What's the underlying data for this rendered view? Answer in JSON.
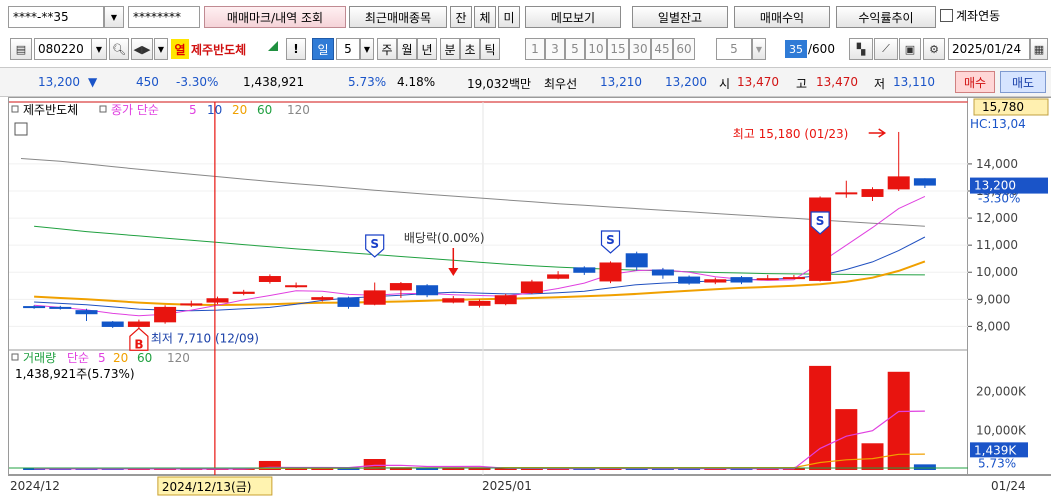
{
  "toolbar1": {
    "account": "****-**35",
    "password": "********",
    "buttons": [
      "매매마크/내역 조회",
      "최근매매종목",
      "잔",
      "체",
      "미",
      "메모보기",
      "일별잔고",
      "매매수익",
      "수익률추이"
    ],
    "account_link_checkbox": "계좌연동"
  },
  "toolbar2": {
    "code": "080220",
    "heat_badge": "열",
    "stock_name": "제주반도체",
    "exclaim": "!",
    "period_active": "일",
    "period_count": "5",
    "periods": [
      "주",
      "월",
      "년",
      "분",
      "초",
      "틱"
    ],
    "intervals": [
      "1",
      "3",
      "5",
      "10",
      "15",
      "30",
      "45",
      "60"
    ],
    "interval_select": "5",
    "count_value": "35",
    "count_total": "/600",
    "date": "2025/01/24"
  },
  "quote": {
    "price": "13,200",
    "direction": "▼",
    "change": "450",
    "change_pct": "-3.30%",
    "volume": "1,438,921",
    "turnover_pct": "5.73%",
    "ratio": "4.18%",
    "amount": "19,032백만",
    "best_label": "최우선",
    "ask": "13,210",
    "bid": "13,200",
    "open_label": "시",
    "open": "13,470",
    "high_label": "고",
    "high": "13,470",
    "low_label": "저",
    "low": "13,110",
    "buy_button": "매수",
    "sell_button": "매도"
  },
  "chart_data": {
    "type": "candlestick",
    "price_panel": {
      "legend_name": "제주반도체",
      "legend_ma_label": "종가 단순",
      "ma_periods": [
        "5",
        "10",
        "20",
        "60",
        "120"
      ],
      "ma_colors": [
        "#e040e0",
        "#2050c0",
        "#f0a000",
        "#20a040",
        "#888888"
      ],
      "yticks": [
        "14,000",
        "13,000",
        "12,000",
        "11,000",
        "10,000",
        "9,000",
        "8,000"
      ],
      "top_price_label": "15,780",
      "hc_label": "HC:13,04",
      "current_label": "13,200",
      "current_pct": "-3.30%",
      "high_annotation": "최고 15,180 (01/23)",
      "low_annotation": "최저 7,710 (12/09)",
      "dividend_annotation": "배당락(0.00%)",
      "buy_marker": "B",
      "sell_marker": "S",
      "candles": [
        {
          "o": 8750,
          "c": 8700,
          "h": 8780,
          "l": 8650
        },
        {
          "o": 8720,
          "c": 8680,
          "h": 8760,
          "l": 8620
        },
        {
          "o": 8600,
          "c": 8450,
          "h": 8650,
          "l": 8200
        },
        {
          "o": 8180,
          "c": 7980,
          "h": 8200,
          "l": 7940
        },
        {
          "o": 7980,
          "c": 8180,
          "h": 8250,
          "l": 7710
        },
        {
          "o": 8150,
          "c": 8720,
          "h": 8780,
          "l": 8100
        },
        {
          "o": 8850,
          "c": 8850,
          "h": 8950,
          "l": 8720
        },
        {
          "o": 8880,
          "c": 9040,
          "h": 9100,
          "l": 8820
        },
        {
          "o": 9200,
          "c": 9280,
          "h": 9350,
          "l": 9150
        },
        {
          "o": 9640,
          "c": 9860,
          "h": 9920,
          "l": 9580
        },
        {
          "o": 9520,
          "c": 9520,
          "h": 9620,
          "l": 9420
        },
        {
          "o": 8980,
          "c": 9080,
          "h": 9120,
          "l": 8920
        },
        {
          "o": 9070,
          "c": 8720,
          "h": 9100,
          "l": 8650
        },
        {
          "o": 8800,
          "c": 9330,
          "h": 9620,
          "l": 8780
        },
        {
          "o": 9330,
          "c": 9600,
          "h": 9640,
          "l": 9050
        },
        {
          "o": 9520,
          "c": 9150,
          "h": 9560,
          "l": 9080
        },
        {
          "o": 8880,
          "c": 9040,
          "h": 9120,
          "l": 8850
        },
        {
          "o": 8760,
          "c": 8940,
          "h": 9000,
          "l": 8700
        },
        {
          "o": 8820,
          "c": 9150,
          "h": 9200,
          "l": 8780
        },
        {
          "o": 9230,
          "c": 9660,
          "h": 9720,
          "l": 9200
        },
        {
          "o": 9760,
          "c": 9920,
          "h": 10040,
          "l": 9740
        },
        {
          "o": 10180,
          "c": 9980,
          "h": 10220,
          "l": 9900
        },
        {
          "o": 9660,
          "c": 10360,
          "h": 10400,
          "l": 9600
        },
        {
          "o": 10700,
          "c": 10180,
          "h": 10760,
          "l": 10060
        },
        {
          "o": 10100,
          "c": 9880,
          "h": 10160,
          "l": 9760
        },
        {
          "o": 9840,
          "c": 9580,
          "h": 9880,
          "l": 9540
        },
        {
          "o": 9620,
          "c": 9740,
          "h": 9800,
          "l": 9560
        },
        {
          "o": 9820,
          "c": 9620,
          "h": 9860,
          "l": 9560
        },
        {
          "o": 9780,
          "c": 9780,
          "h": 9900,
          "l": 9720
        },
        {
          "o": 9820,
          "c": 9820,
          "h": 9900,
          "l": 9760
        },
        {
          "o": 9680,
          "c": 12760,
          "h": 12800,
          "l": 9660
        },
        {
          "o": 12950,
          "c": 12950,
          "h": 13380,
          "l": 12750
        },
        {
          "o": 12780,
          "c": 13070,
          "h": 13140,
          "l": 12630
        },
        {
          "o": 13060,
          "c": 13540,
          "h": 15180,
          "l": 13000
        },
        {
          "o": 13470,
          "c": 13200,
          "h": 13470,
          "l": 13110
        }
      ],
      "ma5": [
        8780,
        8700,
        8610,
        8480,
        8390,
        8450,
        8600,
        8780,
        8980,
        9140,
        9320,
        9300,
        9180,
        9150,
        9210,
        9220,
        9170,
        9140,
        9120,
        9240,
        9400,
        9600,
        9920,
        10060,
        10090,
        10000,
        9830,
        9740,
        9700,
        9720,
        10350,
        11000,
        11650,
        12350,
        12800
      ],
      "ma10": [
        8900,
        8850,
        8800,
        8720,
        8640,
        8600,
        8580,
        8600,
        8650,
        8700,
        8820,
        8960,
        9050,
        9100,
        9150,
        9220,
        9260,
        9230,
        9200,
        9200,
        9240,
        9300,
        9420,
        9540,
        9600,
        9640,
        9680,
        9720,
        9740,
        9780,
        9880,
        10100,
        10380,
        10800,
        11300
      ],
      "ma20": [
        9100,
        9050,
        9000,
        8940,
        8880,
        8830,
        8800,
        8790,
        8800,
        8820,
        8850,
        8870,
        8880,
        8900,
        8920,
        8950,
        8980,
        9000,
        9020,
        9050,
        9080,
        9110,
        9150,
        9200,
        9260,
        9320,
        9370,
        9420,
        9460,
        9500,
        9560,
        9650,
        9800,
        10050,
        10400
      ],
      "ma60": [
        11700,
        11600,
        11500,
        11420,
        11340,
        11260,
        11180,
        11100,
        11020,
        10940,
        10860,
        10790,
        10720,
        10650,
        10580,
        10510,
        10440,
        10370,
        10300,
        10240,
        10190,
        10150,
        10110,
        10080,
        10050,
        10020,
        9990,
        9970,
        9950,
        9940,
        9930,
        9920,
        9910,
        9905,
        9900
      ],
      "ma120": [
        14200,
        14100,
        14000,
        13900,
        13800,
        13710,
        13620,
        13530,
        13440,
        13350,
        13270,
        13190,
        13110,
        13030,
        12950,
        12880,
        12810,
        12740,
        12670,
        12600,
        12530,
        12470,
        12410,
        12350,
        12290,
        12230,
        12170,
        12110,
        12050,
        11990,
        11930,
        11870,
        11810,
        11760,
        11700
      ]
    },
    "volume_panel": {
      "legend_name": "거래량",
      "legend_ma_label": "단순",
      "ma_periods": [
        "5",
        "20",
        "60",
        "120"
      ],
      "summary": "1,438,921주(5.73%)",
      "yticks": [
        "20,000K",
        "10,000K"
      ],
      "current_label": "1,439K",
      "current_pct": "5.73%",
      "volumes": [
        300,
        260,
        220,
        240,
        320,
        260,
        220,
        240,
        260,
        2300,
        260,
        240,
        220,
        2800,
        700,
        420,
        400,
        350,
        300,
        380,
        360,
        340,
        460,
        330,
        330,
        340,
        300,
        300,
        280,
        260,
        26500,
        15500,
        6800,
        25000,
        1439
      ],
      "vma5": [
        300,
        290,
        280,
        270,
        270,
        270,
        260,
        250,
        250,
        650,
        640,
        630,
        620,
        1170,
        1200,
        880,
        900,
        920,
        450,
        410,
        360,
        350,
        370,
        370,
        360,
        360,
        350,
        330,
        310,
        300,
        5500,
        8600,
        10000,
        14900,
        15000
      ],
      "vma20": [
        400,
        390,
        380,
        370,
        360,
        360,
        360,
        360,
        360,
        420,
        430,
        440,
        450,
        520,
        560,
        570,
        580,
        590,
        600,
        620,
        610,
        600,
        600,
        600,
        600,
        600,
        600,
        600,
        600,
        600,
        1900,
        2600,
        2900,
        4000,
        4050
      ]
    },
    "xticks": [
      "2024/12",
      "2025/01",
      "01/24"
    ],
    "crosshair_date": "2024/12/13(금)"
  }
}
